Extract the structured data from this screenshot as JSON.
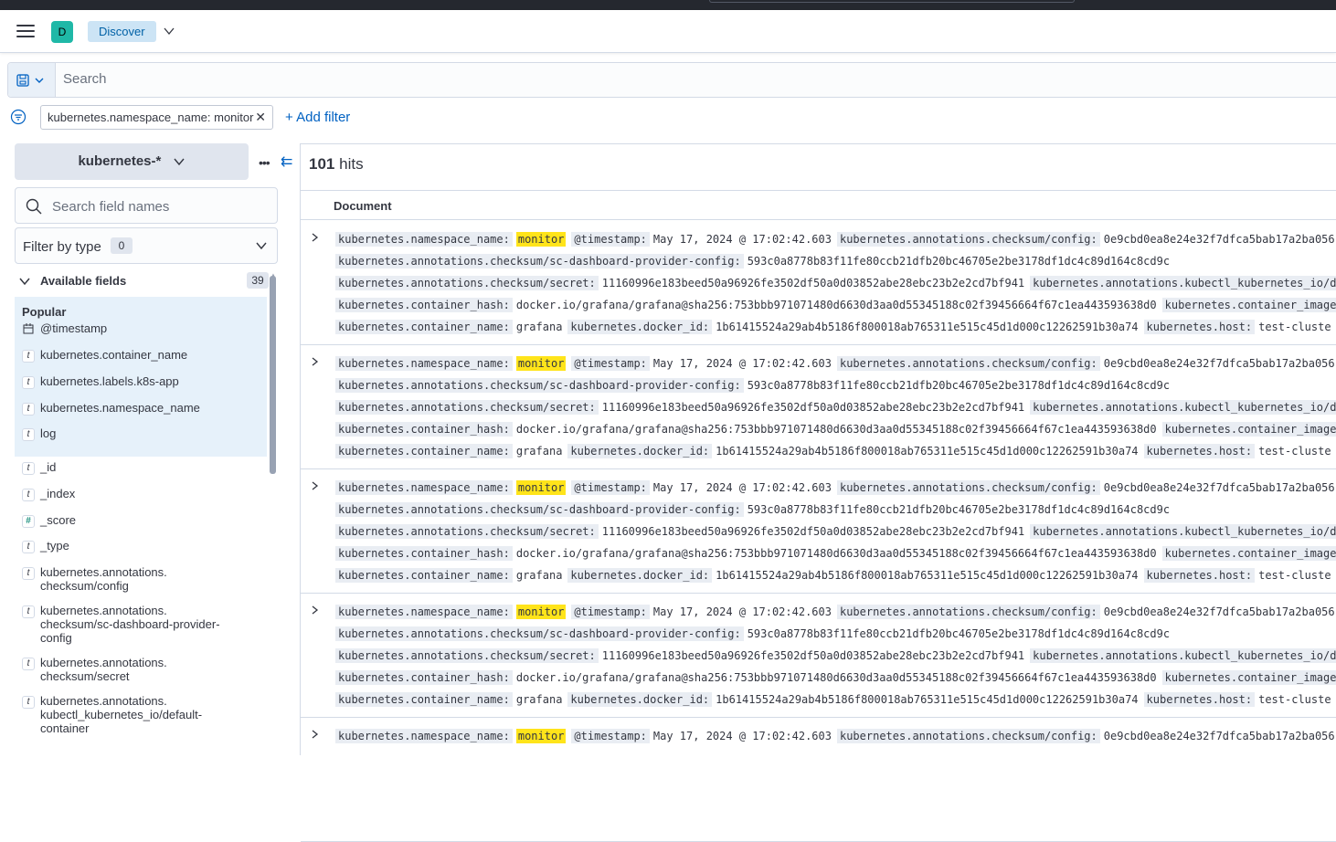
{
  "header": {
    "space_initial": "D",
    "breadcrumb": "Discover"
  },
  "query": {
    "placeholder": "Search"
  },
  "filters": [
    {
      "label": "kubernetes.namespace_name: monitor"
    }
  ],
  "add_filter_label": "+ Add filter",
  "sidebar": {
    "index_pattern": "kubernetes-*",
    "field_search_placeholder": "Search field names",
    "filter_by_type_label": "Filter by type",
    "filter_by_type_count": "0",
    "available_fields_label": "Available fields",
    "available_fields_count": "39",
    "popular_label": "Popular",
    "popular_fields": [
      {
        "type": "date",
        "name": "@timestamp"
      },
      {
        "type": "t",
        "name": "kubernetes.container_name"
      },
      {
        "type": "t",
        "name": "kubernetes.labels.k8s-app"
      },
      {
        "type": "t",
        "name": "kubernetes.namespace_name"
      },
      {
        "type": "t",
        "name": "log"
      }
    ],
    "fields": [
      {
        "type": "t",
        "name": "_id"
      },
      {
        "type": "t",
        "name": "_index"
      },
      {
        "type": "#",
        "name": "_score"
      },
      {
        "type": "t",
        "name": "_type"
      },
      {
        "type": "t",
        "name": "kubernetes.annotations.\nchecksum/config"
      },
      {
        "type": "t",
        "name": "kubernetes.annotations.\nchecksum/sc-dashboard-provider-\nconfig"
      },
      {
        "type": "t",
        "name": "kubernetes.annotations.\nchecksum/secret"
      },
      {
        "type": "t",
        "name": "kubernetes.annotations.\nkubectl_kubernetes_io/default-\ncontainer"
      }
    ]
  },
  "results": {
    "hits_count": "101",
    "hits_label": "hits",
    "column_header": "Document",
    "rows": [
      {
        "lines": [
          [
            {
              "k": "kubernetes.namespace_name:",
              "v": "monitor",
              "hl": true
            },
            {
              "k": "@timestamp:",
              "v": "May 17, 2024 @ 17:02:42.603"
            },
            {
              "k": "kubernetes.annotations.checksum/config:",
              "v": "0e9cbd0ea8e24e32f7dfca5bab17a2ba056"
            }
          ],
          [
            {
              "k": "kubernetes.annotations.checksum/sc-dashboard-provider-config:",
              "v": "593c0a8778b83f11fe80ccb21dfb20bc46705e2be3178df1dc4c89d164c8cd9c"
            }
          ],
          [
            {
              "k": "kubernetes.annotations.checksum/secret:",
              "v": "11160996e183beed50a96926fe3502df50a0d03852abe28ebc23b2e2cd7bf941"
            },
            {
              "k": "kubernetes.annotations.kubectl_kubernetes_io/d",
              "v": ""
            }
          ],
          [
            {
              "k": "kubernetes.container_hash:",
              "v": "docker.io/grafana/grafana@sha256:753bbb971071480d6630d3aa0d55345188c02f39456664f67c1ea443593638d0"
            },
            {
              "k": "kubernetes.container_image",
              "v": ""
            }
          ],
          [
            {
              "k": "kubernetes.container_name:",
              "v": "grafana"
            },
            {
              "k": "kubernetes.docker_id:",
              "v": "1b61415524a29ab4b5186f800018ab765311e515c45d1d000c12262591b30a74"
            },
            {
              "k": "kubernetes.host:",
              "v": "test-cluste"
            }
          ]
        ]
      },
      {
        "lines": [
          [
            {
              "k": "kubernetes.namespace_name:",
              "v": "monitor",
              "hl": true
            },
            {
              "k": "@timestamp:",
              "v": "May 17, 2024 @ 17:02:42.603"
            },
            {
              "k": "kubernetes.annotations.checksum/config:",
              "v": "0e9cbd0ea8e24e32f7dfca5bab17a2ba056"
            }
          ],
          [
            {
              "k": "kubernetes.annotations.checksum/sc-dashboard-provider-config:",
              "v": "593c0a8778b83f11fe80ccb21dfb20bc46705e2be3178df1dc4c89d164c8cd9c"
            }
          ],
          [
            {
              "k": "kubernetes.annotations.checksum/secret:",
              "v": "11160996e183beed50a96926fe3502df50a0d03852abe28ebc23b2e2cd7bf941"
            },
            {
              "k": "kubernetes.annotations.kubectl_kubernetes_io/d",
              "v": ""
            }
          ],
          [
            {
              "k": "kubernetes.container_hash:",
              "v": "docker.io/grafana/grafana@sha256:753bbb971071480d6630d3aa0d55345188c02f39456664f67c1ea443593638d0"
            },
            {
              "k": "kubernetes.container_image",
              "v": ""
            }
          ],
          [
            {
              "k": "kubernetes.container_name:",
              "v": "grafana"
            },
            {
              "k": "kubernetes.docker_id:",
              "v": "1b61415524a29ab4b5186f800018ab765311e515c45d1d000c12262591b30a74"
            },
            {
              "k": "kubernetes.host:",
              "v": "test-cluste"
            }
          ]
        ]
      },
      {
        "lines": [
          [
            {
              "k": "kubernetes.namespace_name:",
              "v": "monitor",
              "hl": true
            },
            {
              "k": "@timestamp:",
              "v": "May 17, 2024 @ 17:02:42.603"
            },
            {
              "k": "kubernetes.annotations.checksum/config:",
              "v": "0e9cbd0ea8e24e32f7dfca5bab17a2ba056"
            }
          ],
          [
            {
              "k": "kubernetes.annotations.checksum/sc-dashboard-provider-config:",
              "v": "593c0a8778b83f11fe80ccb21dfb20bc46705e2be3178df1dc4c89d164c8cd9c"
            }
          ],
          [
            {
              "k": "kubernetes.annotations.checksum/secret:",
              "v": "11160996e183beed50a96926fe3502df50a0d03852abe28ebc23b2e2cd7bf941"
            },
            {
              "k": "kubernetes.annotations.kubectl_kubernetes_io/d",
              "v": ""
            }
          ],
          [
            {
              "k": "kubernetes.container_hash:",
              "v": "docker.io/grafana/grafana@sha256:753bbb971071480d6630d3aa0d55345188c02f39456664f67c1ea443593638d0"
            },
            {
              "k": "kubernetes.container_image",
              "v": ""
            }
          ],
          [
            {
              "k": "kubernetes.container_name:",
              "v": "grafana"
            },
            {
              "k": "kubernetes.docker_id:",
              "v": "1b61415524a29ab4b5186f800018ab765311e515c45d1d000c12262591b30a74"
            },
            {
              "k": "kubernetes.host:",
              "v": "test-cluste"
            }
          ]
        ]
      },
      {
        "lines": [
          [
            {
              "k": "kubernetes.namespace_name:",
              "v": "monitor",
              "hl": true
            },
            {
              "k": "@timestamp:",
              "v": "May 17, 2024 @ 17:02:42.603"
            },
            {
              "k": "kubernetes.annotations.checksum/config:",
              "v": "0e9cbd0ea8e24e32f7dfca5bab17a2ba056"
            }
          ],
          [
            {
              "k": "kubernetes.annotations.checksum/sc-dashboard-provider-config:",
              "v": "593c0a8778b83f11fe80ccb21dfb20bc46705e2be3178df1dc4c89d164c8cd9c"
            }
          ],
          [
            {
              "k": "kubernetes.annotations.checksum/secret:",
              "v": "11160996e183beed50a96926fe3502df50a0d03852abe28ebc23b2e2cd7bf941"
            },
            {
              "k": "kubernetes.annotations.kubectl_kubernetes_io/d",
              "v": ""
            }
          ],
          [
            {
              "k": "kubernetes.container_hash:",
              "v": "docker.io/grafana/grafana@sha256:753bbb971071480d6630d3aa0d55345188c02f39456664f67c1ea443593638d0"
            },
            {
              "k": "kubernetes.container_image",
              "v": ""
            }
          ],
          [
            {
              "k": "kubernetes.container_name:",
              "v": "grafana"
            },
            {
              "k": "kubernetes.docker_id:",
              "v": "1b61415524a29ab4b5186f800018ab765311e515c45d1d000c12262591b30a74"
            },
            {
              "k": "kubernetes.host:",
              "v": "test-cluste"
            }
          ]
        ]
      },
      {
        "lines": [
          [
            {
              "k": "kubernetes.namespace_name:",
              "v": "monitor",
              "hl": true
            },
            {
              "k": "@timestamp:",
              "v": "May 17, 2024 @ 17:02:42.603"
            },
            {
              "k": "kubernetes.annotations.checksum/config:",
              "v": "0e9cbd0ea8e24e32f7dfca5bab17a2ba056"
            }
          ]
        ]
      }
    ]
  }
}
